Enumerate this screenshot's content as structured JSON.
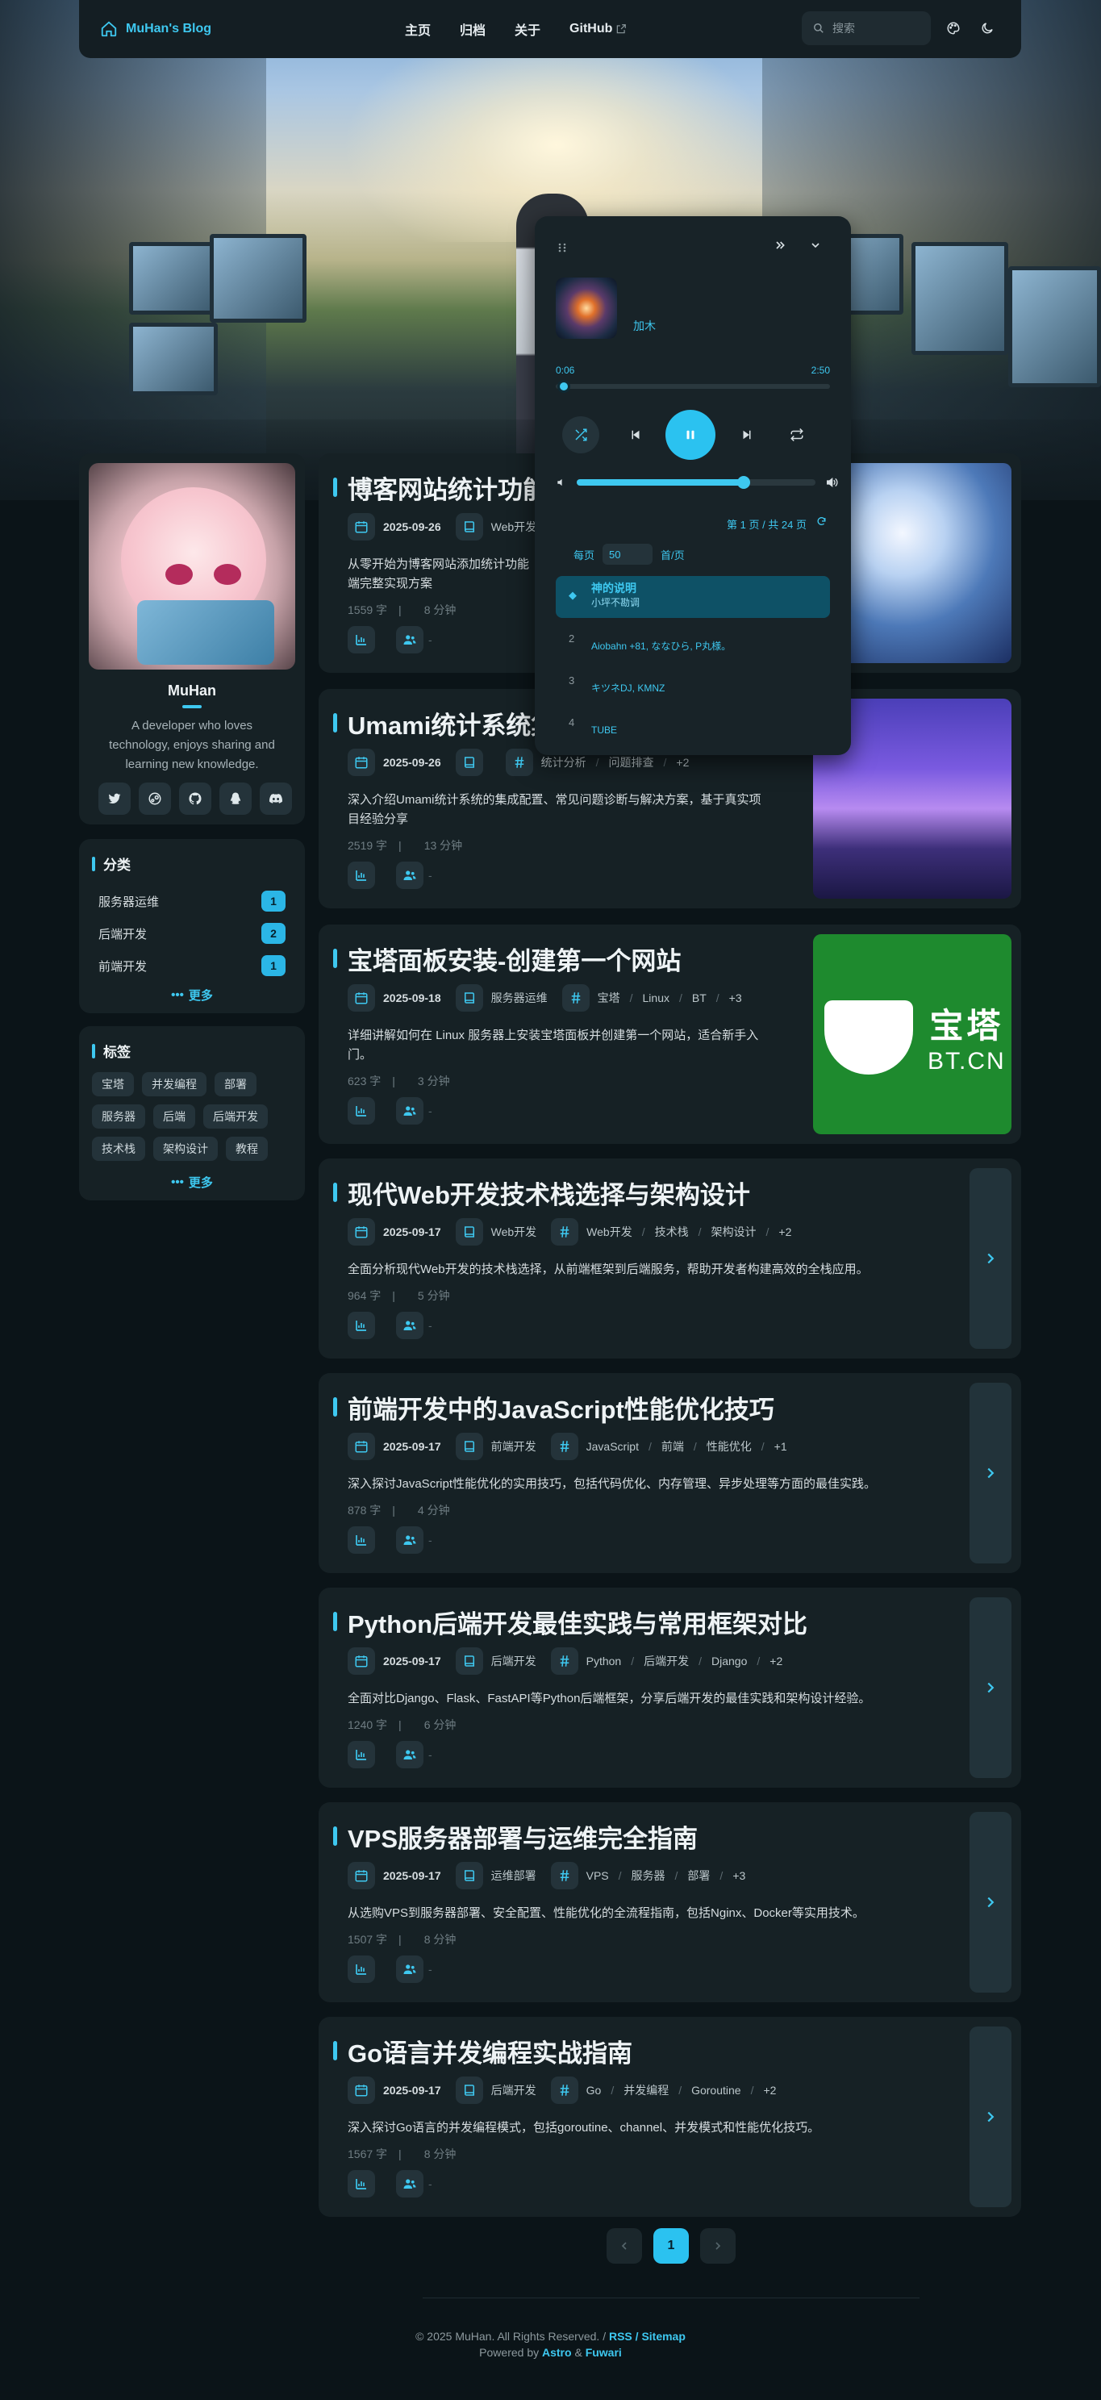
{
  "nav": {
    "brand": "MuHan's Blog",
    "links": [
      "主页",
      "归档",
      "关于",
      "GitHub"
    ],
    "search_placeholder": "搜索"
  },
  "profile": {
    "name": "MuHan",
    "bio": "A developer who loves technology, enjoys sharing and learning new knowledge.",
    "socials": [
      "twitter-icon",
      "steam-icon",
      "github-icon",
      "qq-icon",
      "discord-icon"
    ]
  },
  "categories": {
    "title": "分类",
    "items": [
      {
        "label": "服务器运维",
        "count": "1"
      },
      {
        "label": "后端开发",
        "count": "2"
      },
      {
        "label": "前端开发",
        "count": "1"
      }
    ],
    "more": "更多"
  },
  "tags": {
    "title": "标签",
    "items": [
      "宝塔",
      "并发编程",
      "部署",
      "服务器",
      "后端",
      "后端开发",
      "技术栈",
      "架构设计",
      "教程"
    ],
    "more": "更多"
  },
  "posts": [
    {
      "title": "博客网站统计功能",
      "date": "2025-09-26",
      "category": "Web开发",
      "tags": [],
      "extra": "",
      "desc": "从零开始为博客网站添加统计功能",
      "desc2": "端完整实现方案",
      "words": "1559 字",
      "minutes": "8 分钟",
      "dash": "-"
    },
    {
      "title": "Umami统计系统集",
      "date": "2025-09-26",
      "category": "",
      "tags": [
        "统计分析",
        "问题排查"
      ],
      "extra": "+2",
      "desc": "深入介绍Umami统计系统的集成配置、常见问题诊断与解决方案，基于真实项",
      "desc2": "目经验分享",
      "words": "2519 字",
      "minutes": "13 分钟",
      "dash": "-"
    },
    {
      "title": "宝塔面板安装-创建第一个网站",
      "date": "2025-09-18",
      "category": "服务器运维",
      "tags": [
        "宝塔",
        "Linux",
        "BT"
      ],
      "extra": "+3",
      "desc": "详细讲解如何在 Linux 服务器上安装宝塔面板并创建第一个网站，适合新手入",
      "desc2": "门。",
      "words": "623 字",
      "minutes": "3 分钟",
      "dash": "-"
    },
    {
      "title": "现代Web开发技术栈选择与架构设计",
      "date": "2025-09-17",
      "category": "Web开发",
      "tags": [
        "Web开发",
        "技术栈",
        "架构设计"
      ],
      "extra": "+2",
      "desc": "全面分析现代Web开发的技术栈选择，从前端框架到后端服务，帮助开发者构建高效的全栈应用。",
      "desc2": "",
      "words": "964 字",
      "minutes": "5 分钟",
      "dash": "-"
    },
    {
      "title": "前端开发中的JavaScript性能优化技巧",
      "date": "2025-09-17",
      "category": "前端开发",
      "tags": [
        "JavaScript",
        "前端",
        "性能优化"
      ],
      "extra": "+1",
      "desc": "深入探讨JavaScript性能优化的实用技巧，包括代码优化、内存管理、异步处理等方面的最佳实践。",
      "desc2": "",
      "words": "878 字",
      "minutes": "4 分钟",
      "dash": "-"
    },
    {
      "title": "Python后端开发最佳实践与常用框架对比",
      "date": "2025-09-17",
      "category": "后端开发",
      "tags": [
        "Python",
        "后端开发",
        "Django"
      ],
      "extra": "+2",
      "desc": "全面对比Django、Flask、FastAPI等Python后端框架，分享后端开发的最佳实践和架构设计经验。",
      "desc2": "",
      "words": "1240 字",
      "minutes": "6 分钟",
      "dash": "-"
    },
    {
      "title": "VPS服务器部署与运维完全指南",
      "date": "2025-09-17",
      "category": "运维部署",
      "tags": [
        "VPS",
        "服务器",
        "部署"
      ],
      "extra": "+3",
      "desc": "从选购VPS到服务器部署、安全配置、性能优化的全流程指南，包括Nginx、Docker等实用技术。",
      "desc2": "",
      "words": "1507 字",
      "minutes": "8 分钟",
      "dash": "-"
    },
    {
      "title": "Go语言并发编程实战指南",
      "date": "2025-09-17",
      "category": "后端开发",
      "tags": [
        "Go",
        "并发编程",
        "Goroutine"
      ],
      "extra": "+2",
      "desc": "深入探讨Go语言的并发编程模式，包括goroutine、channel、并发模式和性能优化技巧。",
      "desc2": "",
      "words": "1567 字",
      "minutes": "8 分钟",
      "dash": "-"
    }
  ],
  "thumb_text": {
    "bt_cn": "宝塔",
    "bt_en": "BT.CN"
  },
  "pager": {
    "current": "1"
  },
  "footer": {
    "copyright": "© 2025 MuHan. All Rights Reserved. /",
    "rss": "RSS",
    "slash": "/",
    "sitemap": "Sitemap",
    "powered": "Powered by",
    "astro": "Astro",
    "amp": "&",
    "fuwari": "Fuwari"
  },
  "player": {
    "artist": "加木",
    "current_time": "0:06",
    "duration": "2:50",
    "progress": 0.03,
    "volume": 0.7,
    "page_info": "第 1 页 / 共 24 页",
    "per_page_label": "每页",
    "per_page_value": "50",
    "per_page_unit": "首/页",
    "songs": [
      {
        "n": "1",
        "title": "神的说明",
        "artist": "小坪不勘调",
        "active": true
      },
      {
        "n": "2",
        "title": "",
        "artist": "Aiobahn +81, ななひら, P丸様。",
        "active": false
      },
      {
        "n": "3",
        "title": "",
        "artist": "キツネDJ, KMNZ",
        "active": false
      },
      {
        "n": "4",
        "title": "",
        "artist": "TUBE",
        "active": false
      }
    ]
  },
  "colors": {
    "accent": "#3ec8f0",
    "card": "#162125",
    "bg": "#0b1418"
  }
}
